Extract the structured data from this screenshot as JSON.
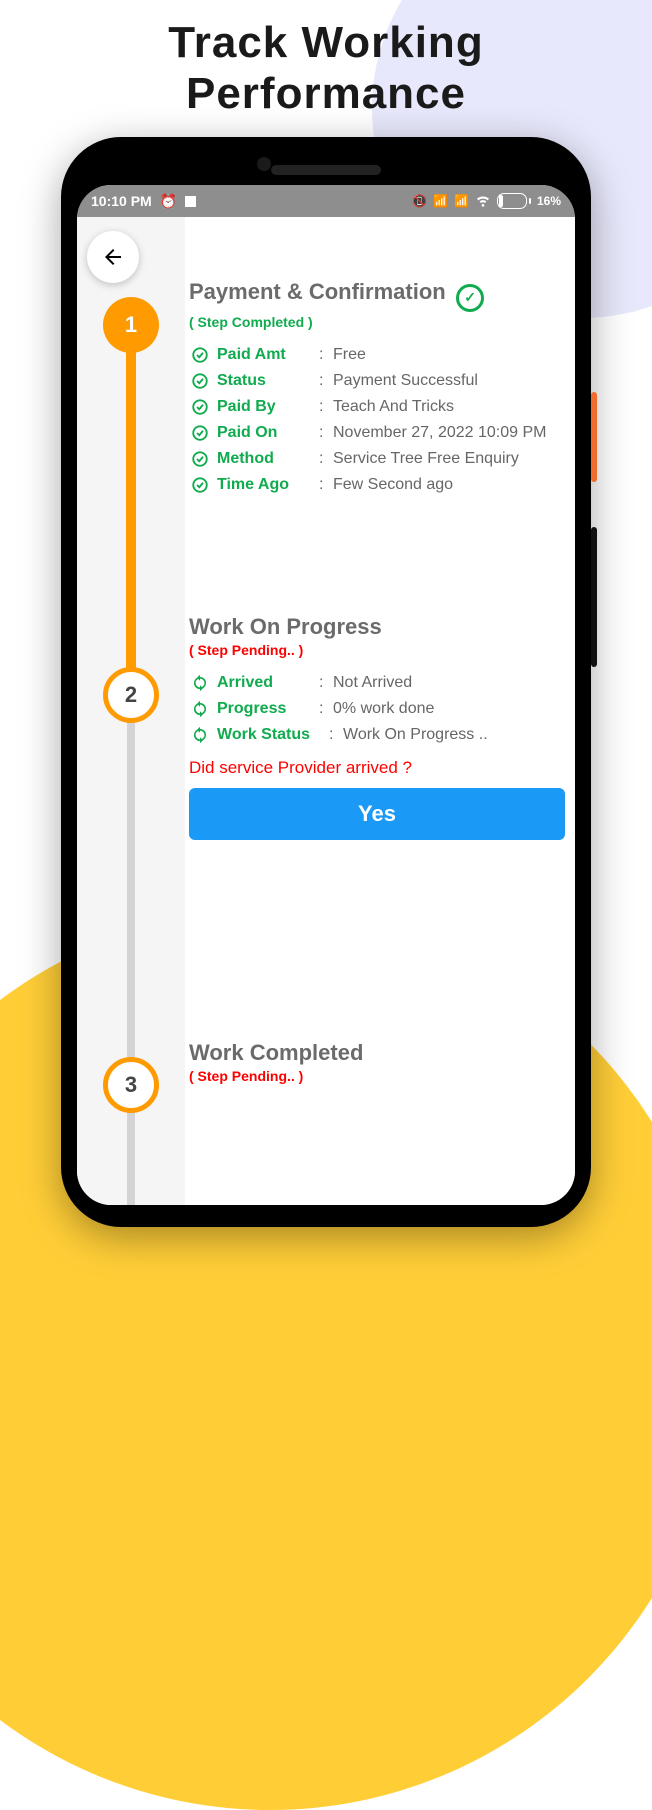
{
  "promo_title_line1": "Track Working",
  "promo_title_line2": "Performance",
  "statusbar": {
    "time": "10:10 PM",
    "battery_text": "16%"
  },
  "sec1": {
    "title": "Payment & Confirmation",
    "sub": "( Step Completed )",
    "rows": {
      "paid_amt_label": "Paid Amt",
      "paid_amt_value": "Free",
      "status_label": "Status",
      "status_value": "Payment Successful",
      "paid_by_label": "Paid By",
      "paid_by_value": "Teach And Tricks",
      "paid_on_label": "Paid On",
      "paid_on_value": "November 27, 2022 10:09 PM",
      "method_label": "Method",
      "method_value": "Service Tree Free Enquiry",
      "time_ago_label": "Time Ago",
      "time_ago_value": "Few Second ago"
    }
  },
  "sec2": {
    "title": "Work On Progress",
    "sub": "( Step Pending.. )",
    "rows": {
      "arrived_label": "Arrived",
      "arrived_value": "Not Arrived",
      "progress_label": "Progress",
      "progress_value": "0% work done",
      "work_status_label": "Work Status",
      "work_status_value": "Work On Progress .."
    },
    "question": "Did service Provider arrived ?",
    "yes_label": "Yes"
  },
  "sec3": {
    "title": "Work Completed",
    "sub": "( Step Pending.. )"
  },
  "steps": {
    "n1": "1",
    "n2": "2",
    "n3": "3"
  }
}
